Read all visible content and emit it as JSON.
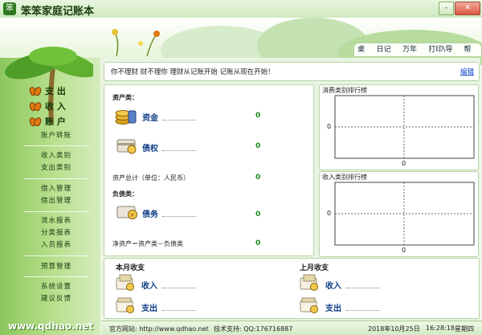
{
  "app": {
    "title": "笨笨家庭记账本",
    "icon_name": "app-logo-icon"
  },
  "window_controls": {
    "minimize": "-",
    "close": "✕"
  },
  "top_menu": [
    "桌面",
    "日记本",
    "万年历",
    "打印\\导出",
    "帮助"
  ],
  "sidebar": {
    "main_nav": [
      "支  出",
      "收  入",
      "账  户"
    ],
    "groups": [
      [
        "账户转账"
      ],
      [
        "收入类别",
        "支出类别"
      ],
      [
        "借入管理",
        "借出管理"
      ],
      [
        "流水报表",
        "分类报表",
        "入员报表"
      ],
      [
        "预算管理"
      ],
      [
        "系统设置",
        "建议反馈"
      ]
    ],
    "site": "www.qdhao.net"
  },
  "notice": {
    "text": "你不理财   财不理你   理财从记账开始   记账从现在开始！",
    "edit": "编辑"
  },
  "assets": {
    "section_label": "资产类：",
    "items": [
      {
        "name": "资金",
        "value": "0",
        "icon": "coins-icon"
      },
      {
        "name": "债权",
        "value": "0",
        "icon": "credit-card-icon"
      }
    ],
    "total_label": "资产总计（单位：人民币）",
    "total_value": "0",
    "liability_label": "负债类：",
    "liabilities": [
      {
        "name": "债务",
        "value": "0",
        "icon": "debt-icon"
      }
    ],
    "net_label": "净资产＝资产类－负债类",
    "net_value": "0"
  },
  "charts": [
    {
      "title": "消费类别排行榜",
      "y_tick": "0",
      "x_tick": "0"
    },
    {
      "title": "收入类别排行榜",
      "y_tick": "0",
      "x_tick": "0"
    }
  ],
  "chart_data": [
    {
      "type": "bar",
      "title": "消费类别排行榜",
      "categories": [],
      "values": [],
      "ytick": "0",
      "xtick": "0"
    },
    {
      "type": "bar",
      "title": "收入类别排行榜",
      "categories": [],
      "values": [],
      "ytick": "0",
      "xtick": "0"
    }
  ],
  "monthly": {
    "this_month": {
      "title": "本月收支",
      "income": "收入",
      "expense": "支出"
    },
    "last_month": {
      "title": "上月收支",
      "income": "收入",
      "expense": "支出"
    }
  },
  "status": {
    "website": "官方网站: http://www.qdhao.net",
    "support": "技术支持: QQ:176716887",
    "date": "2018年10月25日",
    "time": "16:28:18",
    "weekday": "星期四"
  },
  "colors": {
    "accent": "#1a8a1a",
    "link": "#1144cc",
    "sidebar": "#8bc75c",
    "border": "#b7d4a5"
  }
}
